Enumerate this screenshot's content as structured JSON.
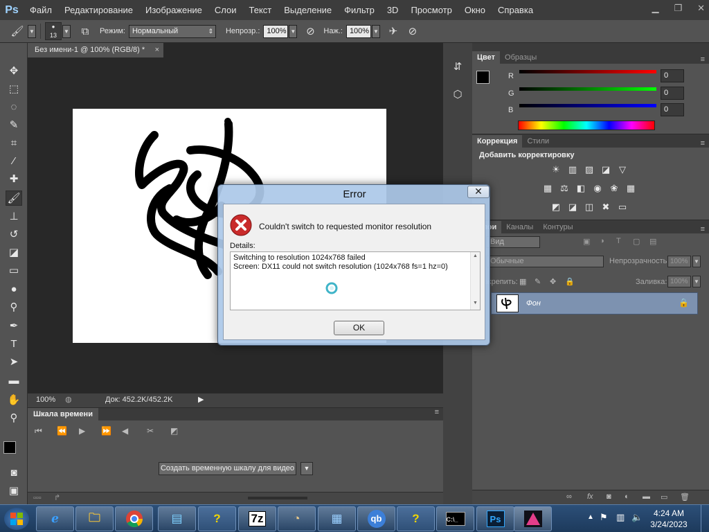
{
  "menu": {
    "logo": "Ps",
    "items": [
      "Файл",
      "Редактирование",
      "Изображение",
      "Слои",
      "Текст",
      "Выделение",
      "Фильтр",
      "3D",
      "Просмотр",
      "Окно",
      "Справка"
    ]
  },
  "options": {
    "brush_size": "13",
    "mode_label": "Режим:",
    "mode_value": "Нормальный",
    "opacity_label": "Непрозр.:",
    "opacity_value": "100%",
    "pressure_label": "Наж.:",
    "pressure_value": "100%"
  },
  "document": {
    "tab_title": "Без имени-1 @ 100% (RGB/8) *",
    "tab_close": "×",
    "zoom": "100%",
    "doc_info": "Док: 452.2K/452.2K"
  },
  "timeline": {
    "tab": "Шкала времени",
    "create_button": "Создать временную шкалу для видео"
  },
  "color_panel": {
    "tabs": [
      "Цвет",
      "Образцы"
    ],
    "channels": [
      {
        "label": "R",
        "value": "0"
      },
      {
        "label": "G",
        "value": "0"
      },
      {
        "label": "B",
        "value": "0"
      }
    ],
    "colors": {
      "fg": "#000000",
      "bg": "#ffffff"
    }
  },
  "adjust_panel": {
    "tabs": [
      "Коррекция",
      "Стили"
    ],
    "title": "Добавить корректировку"
  },
  "layers_panel": {
    "tabs": [
      "Слои",
      "Каналы",
      "Контуры"
    ],
    "kind_label": "Вид",
    "blend_mode": "Обычные",
    "opacity_label": "Непрозрачность:",
    "opacity_value": "100%",
    "lock_label": "Закрепить:",
    "fill_label": "Заливка:",
    "fill_value": "100%",
    "layer_name": "Фон"
  },
  "dialog": {
    "title": "Error",
    "close": "✕",
    "message": "Couldn't switch to requested monitor resolution",
    "details_label": "Details:",
    "details_lines": [
      "Switching to resolution 1024x768 failed",
      "Screen: DX11 could not switch resolution (1024x768 fs=1 hz=0)"
    ],
    "ok_button": "OK"
  },
  "taskbar": {
    "items": [
      "start",
      "ie",
      "explorer",
      "chrome",
      "control-panel",
      "help",
      "7z",
      "clock-app",
      "chart-app",
      "qb",
      "help2",
      "cmd",
      "photoshop",
      "triangle-app"
    ],
    "labels": {
      "sevenzip": "7z",
      "qb": "qb",
      "ps": "Ps"
    },
    "time": "4:24 AM",
    "date": "3/24/2023"
  }
}
